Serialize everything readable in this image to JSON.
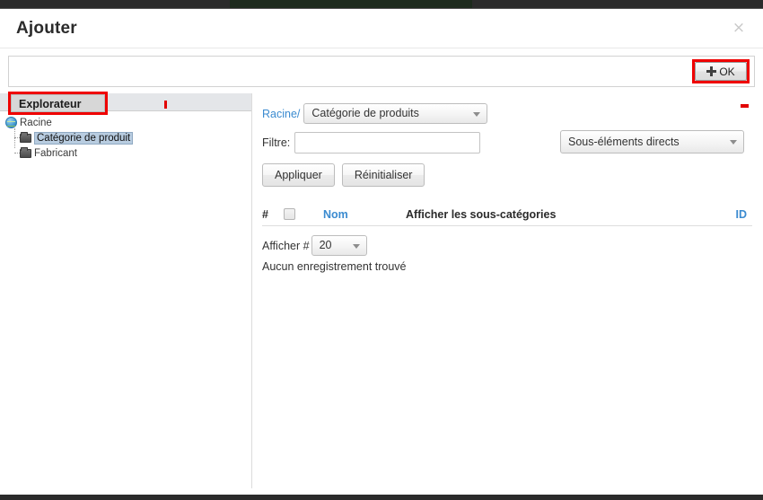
{
  "dialog": {
    "title": "Ajouter",
    "close_icon": "close-icon",
    "close_glyph": "×"
  },
  "toolbar": {
    "ok_label": "OK",
    "ok_icon": "plus-icon"
  },
  "explorer": {
    "tab_label": "Explorateur",
    "tree": [
      {
        "label": "Racine",
        "icon": "globe-icon",
        "selected": false
      },
      {
        "label": "Catégorie de produit",
        "icon": "folder-icon",
        "selected": true
      },
      {
        "label": "Fabricant",
        "icon": "folder-icon",
        "selected": false
      }
    ]
  },
  "main": {
    "breadcrumb_link": "Racine/",
    "category_select": "Catégorie de produits",
    "filter_label": "Filtre:",
    "filter_value": "",
    "filter_placeholder": "",
    "scope_select": "Sous-éléments directs",
    "apply_label": "Appliquer",
    "reset_label": "Réinitialiser",
    "table": {
      "columns": [
        {
          "label": "#",
          "kind": "text"
        },
        {
          "label": "",
          "kind": "checkbox"
        },
        {
          "label": "Nom",
          "kind": "link"
        },
        {
          "label": "Afficher les sous-catégories",
          "kind": "text"
        },
        {
          "label": "ID",
          "kind": "link"
        }
      ],
      "rows": []
    },
    "show_count_label": "Afficher #",
    "show_count_value": "20",
    "empty_message": "Aucun enregistrement trouvé"
  },
  "colors": {
    "accent_link": "#3b8bd0",
    "annotation_red": "#ef0000",
    "selection_blue": "#b8cce0"
  }
}
